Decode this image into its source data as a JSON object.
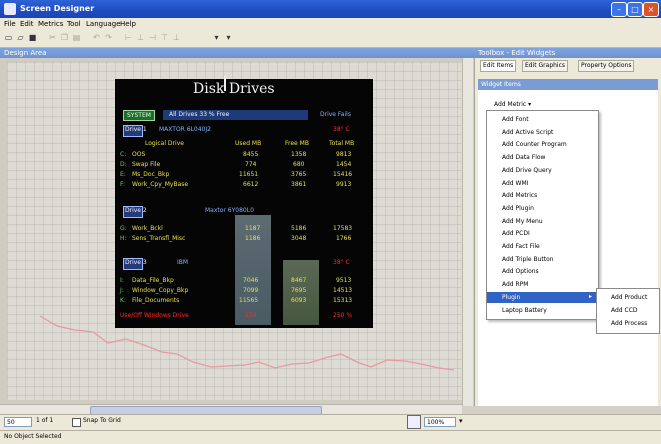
{
  "window": {
    "title": "Screen Designer"
  },
  "menubar": [
    "File",
    "Edit",
    "Metrics",
    "Tool",
    "Language",
    "Help"
  ],
  "left_panel": {
    "header": "Design Area"
  },
  "disk": {
    "title": "Disk Drives",
    "summary_button": "SYSTEM",
    "summary_text": "All Drives 33 % Free",
    "drive_fail": "Drive Fails",
    "drive1": {
      "label": "Drive 1",
      "name": "MAXTOR 6L040J2",
      "temp": "38° C"
    },
    "headers": [
      "Logical Drive",
      "Used MB",
      "Free MB",
      "Total MB"
    ],
    "group1": [
      {
        "name": "OOS",
        "used": "8455",
        "free": "1358",
        "total": "9813"
      },
      {
        "name": "Swap File",
        "used": "774",
        "free": "680",
        "total": "1454"
      },
      {
        "name": "Ms_Doc_Bkp",
        "used": "11651",
        "free": "3765",
        "total": "15416"
      },
      {
        "name": "Work_Cpy_MyBase",
        "used": "6612",
        "free": "3861",
        "total": "9913"
      }
    ],
    "drive2": {
      "label": "Drive 2",
      "name": "Maxtor 6Y080L0"
    },
    "group2": [
      {
        "name": "Work_Bckl",
        "used": "1187",
        "free": "5186",
        "total": "17583"
      },
      {
        "name": "Sens_Transfl_Misc",
        "used": "1186",
        "free": "3048",
        "total": "1766"
      }
    ],
    "drive3": {
      "label": "Drive 3",
      "name": "IBM",
      "temp": "38° C"
    },
    "group3": [
      {
        "name": "Data_File_Bkp",
        "used": "7046",
        "free": "8467",
        "total": "9513"
      },
      {
        "name": "Window_Copy_Bkp",
        "used": "7099",
        "free": "7695",
        "total": "14513"
      },
      {
        "name": "File_Documents",
        "used": "11565",
        "free": "6093",
        "total": "15313"
      }
    ],
    "footer": {
      "name": "Use/Off Windows Drive",
      "used": "150",
      "total": "250 %"
    }
  },
  "right_panel": {
    "header": "Toolbox - Edit Widgets",
    "tabs": [
      "Edit Items",
      "Edit Graphics",
      "Property Options"
    ],
    "section_title": "Widget Items",
    "add_button": "Add Metric",
    "menu_items": [
      "Add Font",
      "Add Active Script",
      "Add Counter Program",
      "Add Data Flow",
      "Add Drive Query",
      "Add WMI",
      "Add Metrics",
      "Add Plugin",
      "Add My Menu",
      "Add PCDI",
      "Add Fact File",
      "Add Triple Button",
      "Add Options",
      "Add RPM",
      "Plugin",
      "Laptop Battery"
    ],
    "highlighted_index": 14,
    "submenu_items": [
      "Add Product",
      "Add CCD",
      "Add Process"
    ]
  },
  "bottom": {
    "zoom_left": "50",
    "page": "1 of 1",
    "snap_label": "Snap To Grid",
    "zoom_right": "100%"
  },
  "status": {
    "text": "No Object Selected"
  },
  "colors": {
    "title_blue": "#1d4cc0",
    "highlight": "#3163c5",
    "disk_bg": "#050505",
    "yellow_text": "#e8e24a",
    "red_text": "#ff2a2a"
  }
}
